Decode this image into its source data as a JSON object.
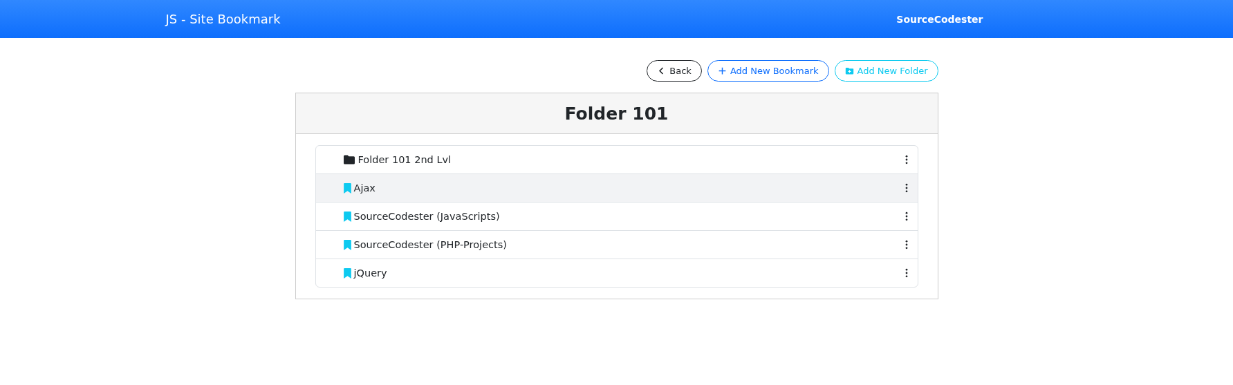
{
  "navbar": {
    "title": "JS - Site Bookmark",
    "brand": "SourceCodester"
  },
  "buttons": [
    {
      "kind": "back",
      "label": "Back"
    },
    {
      "kind": "bookmark",
      "label": "Add New Bookmark"
    },
    {
      "kind": "folder",
      "label": "Add New Folder"
    }
  ],
  "folder": {
    "title": "Folder 101"
  },
  "items": [
    {
      "kind": "folder",
      "label": "Folder 101 2nd Lvl",
      "selected": false
    },
    {
      "kind": "bookmark",
      "label": "Ajax",
      "selected": true
    },
    {
      "kind": "bookmark",
      "label": "SourceCodester (JavaScripts)",
      "selected": false
    },
    {
      "kind": "bookmark",
      "label": "SourceCodester (PHP-Projects)",
      "selected": false
    },
    {
      "kind": "bookmark",
      "label": "jQuery",
      "selected": false
    }
  ]
}
